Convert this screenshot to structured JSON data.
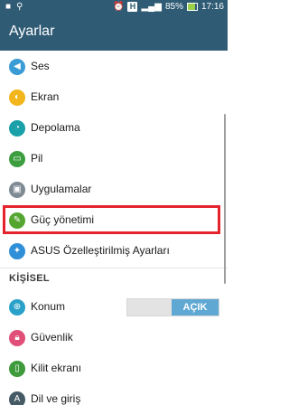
{
  "status_bar": {
    "time": "17:16",
    "battery_percent": "85%",
    "network_badge": "H"
  },
  "app_bar": {
    "title": "Ayarlar"
  },
  "items": [
    {
      "label": "Ses",
      "icon": "sound-icon",
      "color": "#3a9bd5"
    },
    {
      "label": "Ekran",
      "icon": "display-icon",
      "color": "#f2b61c"
    },
    {
      "label": "Depolama",
      "icon": "storage-icon",
      "color": "#19a0a8"
    },
    {
      "label": "Pil",
      "icon": "battery-icon",
      "color": "#3c9e3f"
    },
    {
      "label": "Uygulamalar",
      "icon": "apps-icon",
      "color": "#7f8a93"
    },
    {
      "label": "Güç yönetimi",
      "icon": "power-management-icon",
      "color": "#55a630"
    },
    {
      "label": "ASUS Özelleştirilmiş Ayarları",
      "icon": "asus-custom-icon",
      "color": "#2f8fd8"
    }
  ],
  "section": {
    "title": "KİŞİSEL"
  },
  "personal_items": [
    {
      "label": "Konum",
      "icon": "location-icon",
      "color": "#2aa1c9",
      "toggle": "AÇIK"
    },
    {
      "label": "Güvenlik",
      "icon": "lock-icon",
      "color": "#e04f78"
    },
    {
      "label": "Kilit ekranı",
      "icon": "lock-screen-icon",
      "color": "#3e9a3b"
    },
    {
      "label": "Dil ve giriş",
      "icon": "language-icon",
      "color": "#455a64"
    }
  ],
  "colors": {
    "primary": "#2f5b75",
    "highlight": "#e4232d",
    "toggle_on": "#5fa8d3"
  }
}
